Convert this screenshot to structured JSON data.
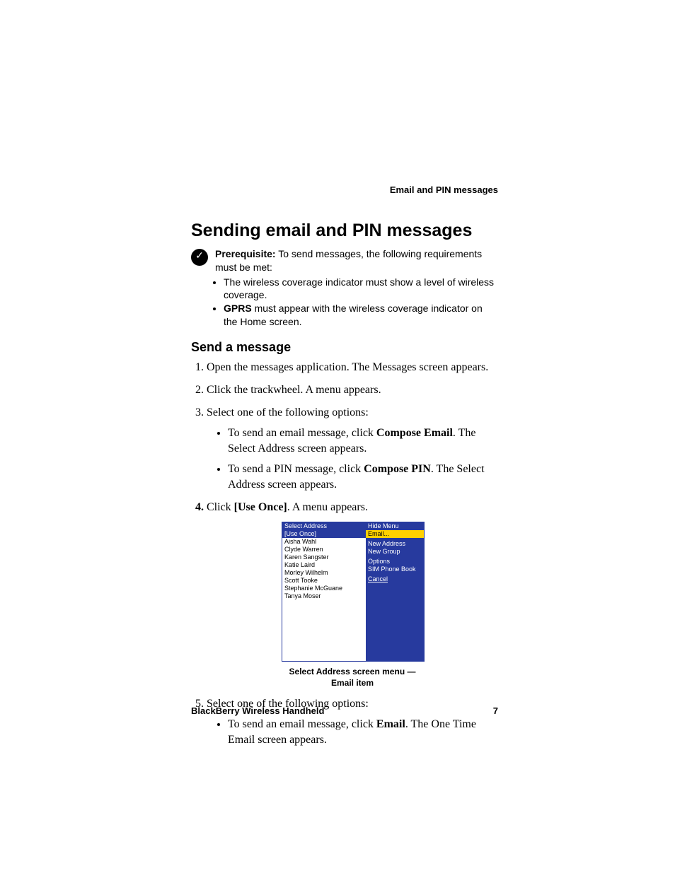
{
  "runningHead": "Email and PIN messages",
  "title": "Sending email and PIN messages",
  "prereq": {
    "label": "Prerequisite:",
    "intro": " To send messages, the following requirements must be met:",
    "bullets": [
      {
        "pre": "",
        "bold": "",
        "text": "The wireless coverage indicator must show a level of wireless coverage."
      },
      {
        "pre": "",
        "bold": "GPRS",
        "text": " must appear with the wireless coverage indicator on the Home screen."
      }
    ]
  },
  "subtitle": "Send a message",
  "steps": {
    "s1": "Open the messages application. The Messages screen appears.",
    "s2": "Click the trackwheel. A menu appears.",
    "s3": "Select one of the following options:",
    "s3a_pre": "To send an email message, click ",
    "s3a_bold": "Compose Email",
    "s3a_post": ". The Select Address screen appears.",
    "s3b_pre": "To send a PIN message, click ",
    "s3b_bold": "Compose PIN",
    "s3b_post": ". The Select Address screen appears.",
    "s4_pre": "Click ",
    "s4_bold": "[Use Once]",
    "s4_post": ". A menu appears.",
    "s5": "Select one of the following options:",
    "s5a_pre": "To send an email message, click ",
    "s5a_bold": "Email",
    "s5a_post": ". The One Time Email screen appears."
  },
  "device": {
    "left": {
      "header": "Select Address",
      "selected": "[Use Once]",
      "names": [
        "Aisha Wahl",
        "Clyde Warren",
        "Karen Sangster",
        "Katie Laird",
        "Morley Wilhelm",
        "Scott Tooke",
        "Stephanie McGuane",
        "Tanya Moser"
      ]
    },
    "right": {
      "header": "Hide Menu",
      "highlight": "Email...",
      "group1": [
        "New Address",
        "New Group"
      ],
      "group2": [
        "Options",
        "SIM Phone Book"
      ],
      "group3": [
        "Cancel"
      ]
    }
  },
  "caption": "Select Address screen menu — Email item",
  "footer": {
    "left": "BlackBerry Wireless Handheld",
    "right": "7"
  }
}
